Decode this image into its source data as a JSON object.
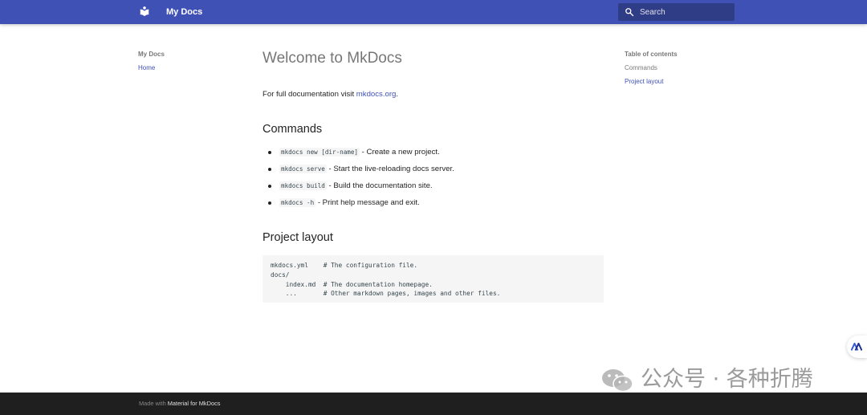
{
  "header": {
    "site_title": "My Docs",
    "search_placeholder": "Search"
  },
  "nav": {
    "title": "My Docs",
    "items": [
      {
        "label": "Home"
      }
    ]
  },
  "toc": {
    "title": "Table of contents",
    "items": [
      {
        "label": "Commands"
      },
      {
        "label": "Project layout"
      }
    ]
  },
  "content": {
    "title": "Welcome to MkDocs",
    "intro_text": "For full documentation visit ",
    "intro_link": "mkdocs.org",
    "intro_end": ".",
    "commands_heading": "Commands",
    "commands": [
      {
        "code": "mkdocs new [dir-name]",
        "text": " - Create a new project."
      },
      {
        "code": "mkdocs serve",
        "text": " - Start the live-reloading docs server."
      },
      {
        "code": "mkdocs build",
        "text": " - Build the documentation site."
      },
      {
        "code": "mkdocs -h",
        "text": " - Print help message and exit."
      }
    ],
    "layout_heading": "Project layout",
    "code_lines": [
      "mkdocs.yml    # The configuration file.",
      "docs/",
      "    index.md  # The documentation homepage.",
      "    ...       # Other markdown pages, images and other files."
    ]
  },
  "footer": {
    "made_with": "Made with ",
    "link": "Material for MkDocs"
  },
  "watermark": {
    "text": "公众号 · 各种折腾"
  },
  "colors": {
    "primary": "#4051b5",
    "footer": "#1f1f1f"
  }
}
